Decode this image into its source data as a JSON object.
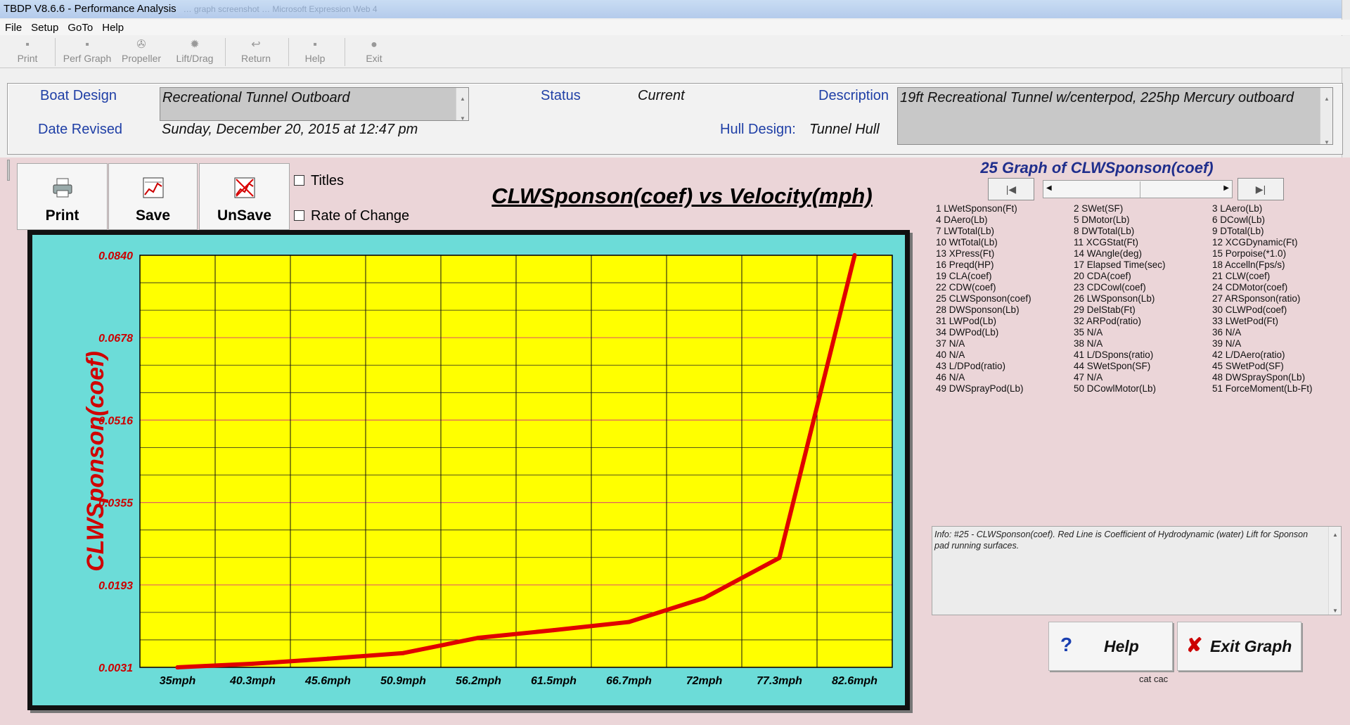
{
  "window": {
    "title": "TBDP V8.6.6 - Performance Analysis",
    "title_ghost": "… graph screenshot … Microsoft Expression Web 4"
  },
  "menu": [
    "File",
    "Setup",
    "GoTo",
    "Help"
  ],
  "toolbar": [
    {
      "label": "Print",
      "icon": "printer-icon"
    },
    {
      "label": "Perf Graph",
      "icon": "graph-icon"
    },
    {
      "label": "Propeller",
      "icon": "propeller-icon"
    },
    {
      "label": "Lift/Drag",
      "icon": "gear-icon"
    },
    {
      "label": "Return",
      "icon": "return-icon"
    },
    {
      "label": "Help",
      "icon": "help-icon"
    },
    {
      "label": "Exit",
      "icon": "exit-icon"
    }
  ],
  "boat": {
    "design_label": "Boat Design",
    "design_value": "Recreational Tunnel Outboard",
    "date_label": "Date Revised",
    "date_value": "Sunday, December 20, 2015 at 12:47 pm",
    "status_label": "Status",
    "status_value": "Current",
    "hull_label": "Hull Design:",
    "hull_value": "Tunnel Hull",
    "description_label": "Description",
    "description_value": "19ft Recreational Tunnel w/centerpod, 225hp Mercury outboard"
  },
  "graph_buttons": {
    "print": "Print",
    "save": "Save",
    "unsave": "UnSave"
  },
  "options": {
    "titles": "Titles",
    "rate": "Rate of Change"
  },
  "chart_title": "CLWSponson(coef) vs Velocity(mph)",
  "graph_panel_title": "25 Graph of CLWSponson(coef)",
  "graph_list": [
    [
      "1 LWetSponson(Ft)",
      "2 SWet(SF)",
      "3 LAero(Lb)"
    ],
    [
      "4 DAero(Lb)",
      "5 DMotor(Lb)",
      "6 DCowl(Lb)"
    ],
    [
      "7 LWTotal(Lb)",
      "8 DWTotal(Lb)",
      "9 DTotal(Lb)"
    ],
    [
      "10 WtTotal(Lb)",
      "11 XCGStat(Ft)",
      "12 XCGDynamic(Ft)"
    ],
    [
      "13 XPress(Ft)",
      "14 WAngle(deg)",
      "15 Porpoise(*1.0)"
    ],
    [
      "16 Preqd(HP)",
      "17 Elapsed Time(sec)",
      "18 Accelln(Fps/s)"
    ],
    [
      "19 CLA(coef)",
      "20 CDA(coef)",
      "21 CLW(coef)"
    ],
    [
      "22 CDW(coef)",
      "23 CDCowl(coef)",
      "24 CDMotor(coef)"
    ],
    [
      "25 CLWSponson(coef)",
      "26 LWSponson(Lb)",
      "27 ARSponson(ratio)"
    ],
    [
      "28 DWSponson(Lb)",
      "29 DelStab(Ft)",
      "30 CLWPod(coef)"
    ],
    [
      "31 LWPod(Lb)",
      "32 ARPod(ratio)",
      "33 LWetPod(Ft)"
    ],
    [
      "34 DWPod(Lb)",
      "35 N/A",
      "36 N/A"
    ],
    [
      "37 N/A",
      "38 N/A",
      "39 N/A"
    ],
    [
      "40 N/A",
      "41 L/DSpons(ratio)",
      "42 L/DAero(ratio)"
    ],
    [
      "43 L/DPod(ratio)",
      "44 SWetSpon(SF)",
      "45 SWetPod(SF)"
    ],
    [
      "46 N/A",
      "47 N/A",
      "48 DWSpraySpon(Lb)"
    ],
    [
      "49 DWSprayPod(Lb)",
      "50 DCowlMotor(Lb)",
      "51 ForceMoment(Lb-Ft)"
    ]
  ],
  "info_text": "Info: #25 - CLWSponson(coef). Red Line is Coefficient of Hydrodynamic (water) Lift for Sponson pad running surfaces.",
  "actions": {
    "help": "Help",
    "exit": "Exit Graph"
  },
  "footer_text": "cat cac",
  "colors": {
    "plot_bg": "#ffff00",
    "outer_bg": "#6cdcd8",
    "line": "#e00000",
    "grid_major": "#111111",
    "grid_minor": "#e06060",
    "axis_text": "#cc0000"
  },
  "chart_data": {
    "type": "line",
    "title": "CLWSponson(coef) vs Velocity(mph)",
    "xlabel": "",
    "ylabel": "CLWSponson(coef)",
    "categories": [
      "35mph",
      "40.3mph",
      "45.6mph",
      "50.9mph",
      "56.2mph",
      "61.5mph",
      "66.7mph",
      "72mph",
      "77.3mph",
      "82.6mph"
    ],
    "y_ticks": [
      "0.0840",
      "0.0678",
      "0.0516",
      "0.0355",
      "0.0193",
      "0.0031"
    ],
    "ylim": [
      0.0031,
      0.084
    ],
    "series": [
      {
        "x": [
          35,
          40.3,
          45.6,
          50.9,
          56.2,
          61.5,
          66.7,
          72,
          77.3,
          82.6
        ],
        "values": [
          0.0031,
          0.0038,
          0.0048,
          0.0059,
          0.0089,
          0.0104,
          0.012,
          0.0167,
          0.0246,
          0.084
        ]
      }
    ],
    "grid": true,
    "legend": "none"
  }
}
